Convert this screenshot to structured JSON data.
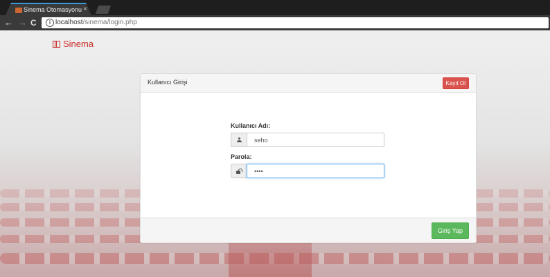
{
  "browser": {
    "tab_title": "Sinema Otomasyonu",
    "tab_close": "×",
    "url_host": "localhost",
    "url_path": "/sinema/login.php",
    "back": "←",
    "forward": "→",
    "reload": "C",
    "info": "i"
  },
  "brand": {
    "name": "Sinema",
    "icon": "film-icon",
    "color": "#c9302c"
  },
  "panel": {
    "title": "Kullanıcı Girişi",
    "register_label": "Kayıt Ol",
    "username_label": "Kullanıcı Adı:",
    "username_value": "seho",
    "username_icon": "user-icon",
    "password_label": "Parola:",
    "password_value": "••••",
    "password_icon": "lock-icon",
    "login_label": "Giriş Yap"
  },
  "colors": {
    "danger": "#d9534f",
    "success": "#5cb85c",
    "focus": "#66afe9"
  }
}
